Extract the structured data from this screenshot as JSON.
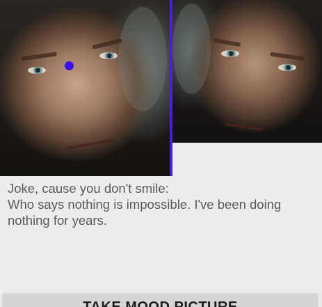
{
  "images": {
    "left_photo": "face-photo",
    "right_photo": "face-photo-mirrored"
  },
  "colors": {
    "divider": "#4a1fd6",
    "marker": "#3b12e6",
    "background": "#ececec",
    "text": "#5b5b5b",
    "button_bg": "#d6d6d6"
  },
  "joke": {
    "title": "Joke, cause you don't smile:",
    "body": "Who says nothing is impossible. I've been doing nothing for years."
  },
  "button": {
    "label": "TAKE MOOD PICTURE"
  }
}
